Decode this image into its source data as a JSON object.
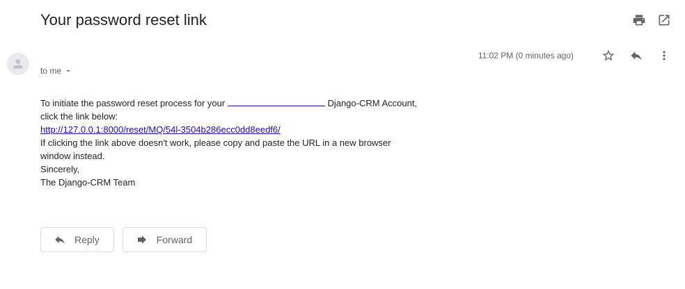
{
  "email": {
    "subject": "Your password reset link",
    "recipient_label": "to me",
    "timestamp": "11:02 PM (0 minutes ago)",
    "body": {
      "line1_before": "To initiate the password reset process for your",
      "line1_after": "Django-CRM Account,",
      "line2": "click the link below:",
      "reset_link": "http://127.0.0.1:8000/reset/MQ/54l-3504b286ecc0dd8eedf6/",
      "line4": "If clicking the link above doesn't work, please copy and paste the URL in a new browser",
      "line5": "window instead.",
      "line6": "Sincerely,",
      "line7": "The Django-CRM Team"
    }
  },
  "actions": {
    "reply_label": "Reply",
    "forward_label": "Forward"
  },
  "icons": {
    "print": "print-icon",
    "open_new_window": "open-in-new-icon",
    "star": "star-icon",
    "reply": "reply-icon",
    "more": "more-vert-icon",
    "avatar": "person-icon",
    "dropdown": "caret-down-icon",
    "forward": "forward-icon"
  },
  "colors": {
    "link": "#1a0dab",
    "muted": "#5f6368",
    "border": "#dadce0"
  }
}
